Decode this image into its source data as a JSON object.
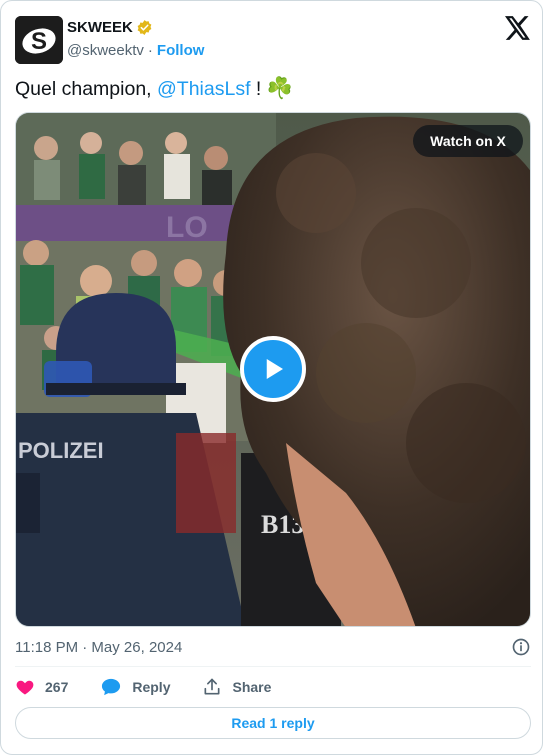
{
  "author": {
    "display_name": "SKWEEK",
    "handle": "@skweektv",
    "separator": "·",
    "follow_label": "Follow",
    "avatar_letter": "S"
  },
  "tweet": {
    "text_before": "Quel champion, ",
    "mention": "@ThiasLsf",
    "text_after": " ! ",
    "emoji": "☘️"
  },
  "media": {
    "watch_label": "Watch on X",
    "play_icon": "play-icon",
    "jersey_text_1": "POLIZEI",
    "jersey_text_2": "B13"
  },
  "meta": {
    "timestamp": "11:18 PM · May 26, 2024"
  },
  "actions": {
    "like_count": "267",
    "reply_label": "Reply",
    "share_label": "Share"
  },
  "read_replies_label": "Read 1 reply",
  "colors": {
    "accent": "#1d9bf0",
    "like": "#f91880",
    "verified_gold": "#e2b719",
    "text_secondary": "#536471"
  }
}
